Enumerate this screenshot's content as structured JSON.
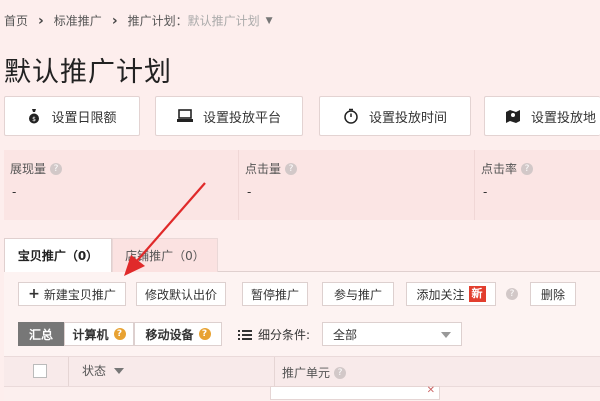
{
  "breadcrumb": {
    "home": "首页",
    "level2": "标准推广",
    "level3_label": "推广计划：",
    "level3_value": "默认推广计划"
  },
  "page_title": "默认推广计划",
  "setting_buttons": [
    {
      "label": "设置日限额",
      "icon": "money-bag-icon"
    },
    {
      "label": "设置投放平台",
      "icon": "computer-icon"
    },
    {
      "label": "设置投放时间",
      "icon": "stopwatch-icon"
    },
    {
      "label": "设置投放地",
      "icon": "map-pin-icon"
    }
  ],
  "stats": [
    {
      "label": "展现量",
      "value": "-"
    },
    {
      "label": "点击量",
      "value": "-"
    },
    {
      "label": "点击率",
      "value": "-"
    }
  ],
  "tabs": [
    {
      "label": "宝贝推广（0）",
      "active": true
    },
    {
      "label": "店铺推广（0）",
      "active": false
    }
  ],
  "actions": {
    "new_item": "新建宝贝推广",
    "modify_bid": "修改默认出价",
    "pause": "暂停推广",
    "join": "参与推广",
    "follow": "添加关注",
    "follow_badge": "新",
    "delete": "删除"
  },
  "filters": {
    "summary": "汇总",
    "computer": "计算机",
    "mobile": "移动设备",
    "segment_label": "细分条件:",
    "segment_value": "全部"
  },
  "table": {
    "col_status": "状态",
    "col_unit": "推广单元"
  },
  "colors": {
    "background": "#fdeeed",
    "arrow": "#e02a2a",
    "badge": "#e23e2e",
    "help_orange": "#e8a232"
  }
}
